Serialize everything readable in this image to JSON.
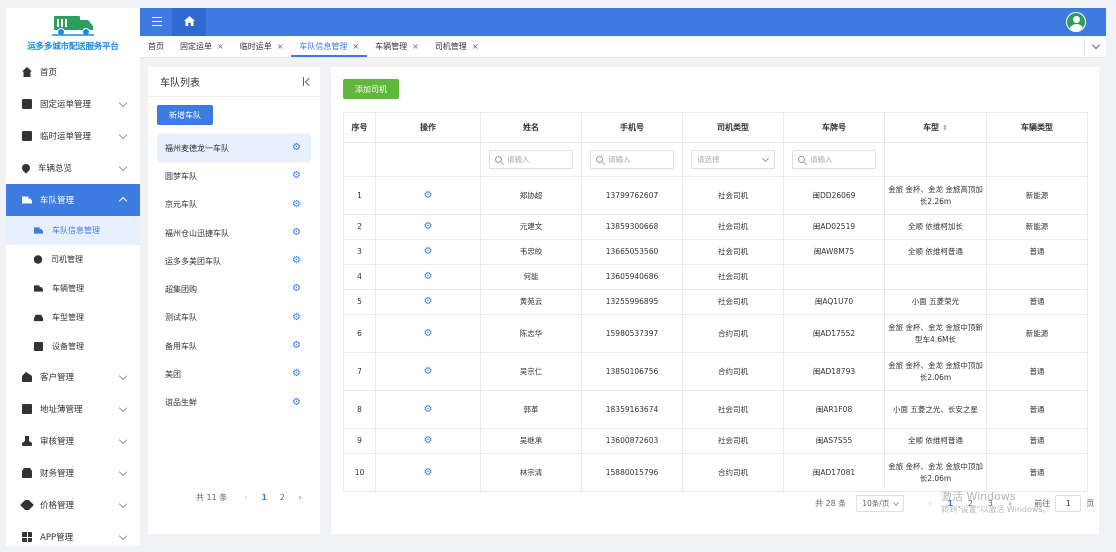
{
  "app": {
    "logo_text": "运多多城市配送服务平台"
  },
  "sidebar": {
    "items": [
      {
        "label": "首页",
        "icon": "home-icon",
        "expandable": false
      },
      {
        "label": "固定运单管理",
        "icon": "document-icon",
        "expandable": true
      },
      {
        "label": "临时运单管理",
        "icon": "document-icon",
        "expandable": true
      },
      {
        "label": "车辆总览",
        "icon": "location-pin-icon",
        "expandable": true
      },
      {
        "label": "车队管理",
        "icon": "truck-icon",
        "expandable": true,
        "open": true,
        "active": true,
        "children": [
          {
            "label": "车队信息管理",
            "icon": "truck-icon",
            "active": true
          },
          {
            "label": "司机管理",
            "icon": "user-icon"
          },
          {
            "label": "车辆管理",
            "icon": "truck-icon"
          },
          {
            "label": "车型管理",
            "icon": "car-icon"
          },
          {
            "label": "设备管理",
            "icon": "device-icon"
          }
        ]
      },
      {
        "label": "客户管理",
        "icon": "users-icon",
        "expandable": true
      },
      {
        "label": "地址薄管理",
        "icon": "address-book-icon",
        "expandable": true
      },
      {
        "label": "审核管理",
        "icon": "user-check-icon",
        "expandable": true
      },
      {
        "label": "财务管理",
        "icon": "finance-icon",
        "expandable": true
      },
      {
        "label": "价格管理",
        "icon": "tag-icon",
        "expandable": true
      },
      {
        "label": "APP管理",
        "icon": "grid-icon",
        "expandable": true
      }
    ]
  },
  "tabs": [
    {
      "label": "首页",
      "closable": false
    },
    {
      "label": "固定运单",
      "closable": true
    },
    {
      "label": "临时运单",
      "closable": true
    },
    {
      "label": "车队信息管理",
      "closable": true,
      "active": true
    },
    {
      "label": "车辆管理",
      "closable": true
    },
    {
      "label": "司机管理",
      "closable": true
    }
  ],
  "fleet_panel": {
    "title": "车队列表",
    "add_button": "新增车队",
    "items": [
      "福州麦德龙一车队",
      "圆梦车队",
      "京元车队",
      "福州仓山迅捷车队",
      "运多多美团车队",
      "超集团购",
      "测试车队",
      "备用车队",
      "美团",
      "谊品生鲜"
    ],
    "active_index": 0,
    "pagination": {
      "total_text": "共 11 条",
      "pages": [
        "1",
        "2"
      ],
      "current": "1",
      "prev": "‹",
      "next": "›"
    }
  },
  "driver_panel": {
    "add_button": "添加司机",
    "columns": [
      "序号",
      "操作",
      "姓名",
      "手机号",
      "司机类型",
      "车牌号",
      "车型",
      "车辆类型"
    ],
    "sort_icon": "⇕",
    "filters": {
      "name_placeholder": "请输入",
      "phone_placeholder": "请输入",
      "type_placeholder": "请选择",
      "plate_placeholder": "请输入"
    },
    "rows": [
      {
        "no": "1",
        "name": "郑协超",
        "phone": "13799762607",
        "driver_type": "社会司机",
        "plate": "闽DD26069",
        "model": "金旅 金杯、金龙 金旅高顶加长2.26m",
        "vehicle_type": "新能源"
      },
      {
        "no": "2",
        "name": "元建文",
        "phone": "13859300668",
        "driver_type": "社会司机",
        "plate": "闽AD02519",
        "model": "全顺 依维柯加长",
        "vehicle_type": "新能源"
      },
      {
        "no": "3",
        "name": "韦忠皎",
        "phone": "13665053560",
        "driver_type": "社会司机",
        "plate": "闽AW8M75",
        "model": "全顺 依维柯普通",
        "vehicle_type": "普通"
      },
      {
        "no": "4",
        "name": "何能",
        "phone": "13605940686",
        "driver_type": "社会司机",
        "plate": "",
        "model": "",
        "vehicle_type": ""
      },
      {
        "no": "5",
        "name": "黄苑云",
        "phone": "13255996895",
        "driver_type": "社会司机",
        "plate": "闽AQ1U70",
        "model": "小面 五菱荣光",
        "vehicle_type": "普通"
      },
      {
        "no": "6",
        "name": "陈志华",
        "phone": "15980537397",
        "driver_type": "合约司机",
        "plate": "闽AD17552",
        "model": "金旅 金杯、金龙 金旅中顶新型车4.6M长",
        "vehicle_type": "新能源"
      },
      {
        "no": "7",
        "name": "吴宗仁",
        "phone": "13850106756",
        "driver_type": "合约司机",
        "plate": "闽AD18793",
        "model": "金旅 金杯、金龙 金旅中顶加长2.06m",
        "vehicle_type": "普通"
      },
      {
        "no": "8",
        "name": "郭革",
        "phone": "18359163674",
        "driver_type": "社会司机",
        "plate": "闽AR1F08",
        "model": "小面 五菱之光、长安之星",
        "vehicle_type": "普通"
      },
      {
        "no": "9",
        "name": "吴继承",
        "phone": "13600872603",
        "driver_type": "社会司机",
        "plate": "闽AS7S55",
        "model": "全顺 依维柯普通",
        "vehicle_type": "普通"
      },
      {
        "no": "10",
        "name": "林宗清",
        "phone": "15880015796",
        "driver_type": "合约司机",
        "plate": "闽AD17081",
        "model": "金旅 金杯、金龙 金旅中顶加长2.06m",
        "vehicle_type": "普通"
      }
    ],
    "pagination": {
      "total_text": "共 28 条",
      "page_size": "10条/页",
      "pages": [
        "1",
        "2",
        "3"
      ],
      "current": "1",
      "prev": "‹",
      "next": "›",
      "goto_label": "前往",
      "goto_value": "1",
      "goto_suffix": "页"
    }
  },
  "watermark": {
    "line1": "激活 Windows",
    "line2": "转到\"设置\"以激活 Windows。"
  },
  "colors": {
    "primary": "#3d7be0",
    "success": "#5fb83a",
    "logo_green": "#2e9e5e"
  }
}
